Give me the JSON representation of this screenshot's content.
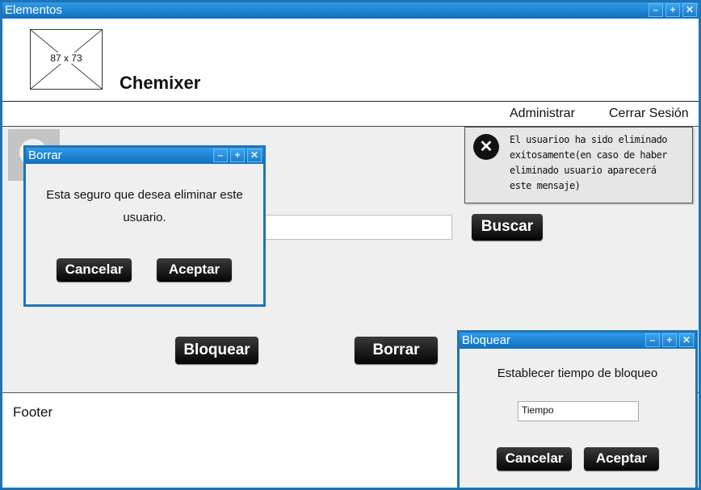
{
  "window": {
    "title": "Elementos",
    "controls": [
      "–",
      "+",
      "✕"
    ]
  },
  "header": {
    "logo_label": "87 x 73",
    "brand": "Chemixer"
  },
  "nav": {
    "admin": "Administrar",
    "logout": "Cerrar Sesión"
  },
  "alert": {
    "icon": "close-circle-icon",
    "message": "El usuarioo ha sido eliminado exitosamente(en caso de haber eliminado usuario aparecerá este mensaje)"
  },
  "search": {
    "button": "Buscar"
  },
  "actions": {
    "block": "Bloquear",
    "delete": "Borrar"
  },
  "footer": {
    "text": "Footer"
  },
  "dialog_delete": {
    "title": "Borrar",
    "message": "Esta seguro que desea eliminar este usuario.",
    "cancel": "Cancelar",
    "accept": "Aceptar"
  },
  "dialog_block": {
    "title": "Bloquear",
    "message": "Establecer tiempo de bloqueo",
    "input_value": "Tiempo",
    "cancel": "Cancelar",
    "accept": "Aceptar"
  },
  "colors": {
    "titlebar": "#1f74b5",
    "button": "#111111"
  }
}
